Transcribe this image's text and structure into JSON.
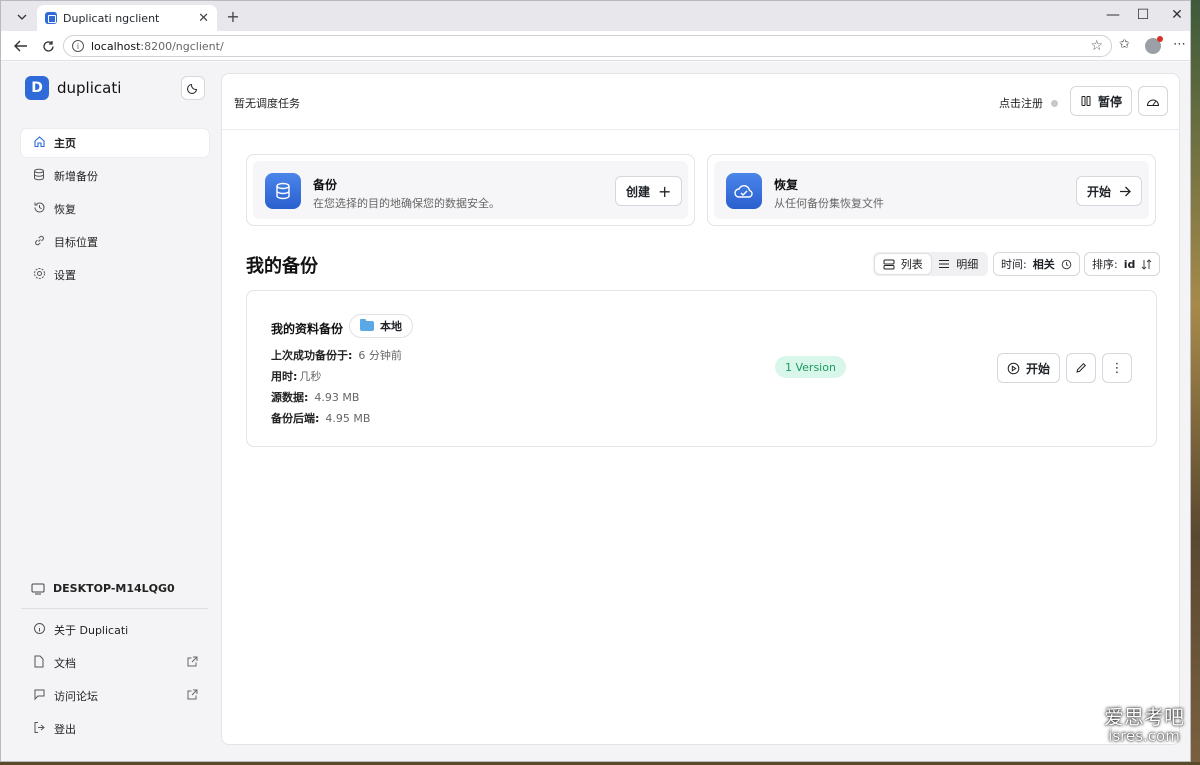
{
  "browser": {
    "tab_title": "Duplicati ngclient",
    "url_host": "localhost",
    "url_path": ":8200/ngclient/"
  },
  "sidebar": {
    "brand": "duplicati",
    "nav": [
      {
        "label": "主页",
        "icon": "home-icon"
      },
      {
        "label": "新增备份",
        "icon": "database-icon"
      },
      {
        "label": "恢复",
        "icon": "history-icon"
      },
      {
        "label": "目标位置",
        "icon": "link-icon"
      },
      {
        "label": "设置",
        "icon": "gear-icon"
      }
    ],
    "device_name": "DESKTOP-M14LQG0",
    "bottom": [
      {
        "label": "关于 Duplicati",
        "icon": "info-icon"
      },
      {
        "label": "文档",
        "icon": "doc-icon"
      },
      {
        "label": "访问论坛",
        "icon": "forum-icon"
      },
      {
        "label": "登出",
        "icon": "logout-icon"
      }
    ]
  },
  "topbar": {
    "schedule_text": "暂无调度任务",
    "register_text": "点击注册",
    "pause_label": "暂停"
  },
  "cards": {
    "backup": {
      "title": "备份",
      "subtitle": "在您选择的目的地确保您的数据安全。",
      "button": "创建"
    },
    "restore": {
      "title": "恢复",
      "subtitle": "从任何备份集恢复文件",
      "button": "开始"
    }
  },
  "list": {
    "section_title": "我的备份",
    "view_list": "列表",
    "view_detail": "明细",
    "time_label": "时间:",
    "time_value": "相关",
    "sort_label": "排序:",
    "sort_value": "id"
  },
  "job": {
    "name": "我的资料备份",
    "destination": "本地",
    "last_success_label": "上次成功备份于:",
    "last_success_value": "6 分钟前",
    "duration_label": "用时:",
    "duration_value": "几秒",
    "source_label": "源数据:",
    "source_value": "4.93 MB",
    "backend_label": "备份后端:",
    "backend_value": "4.95 MB",
    "version_badge": "1 Version",
    "run_label": "开始"
  },
  "watermark": {
    "line1": "爱思考吧",
    "line2": "isres.com"
  },
  "colors": {
    "brand": "#2f6bd8",
    "badge_bg": "#d9f6ea",
    "badge_text": "#1a9b62"
  }
}
